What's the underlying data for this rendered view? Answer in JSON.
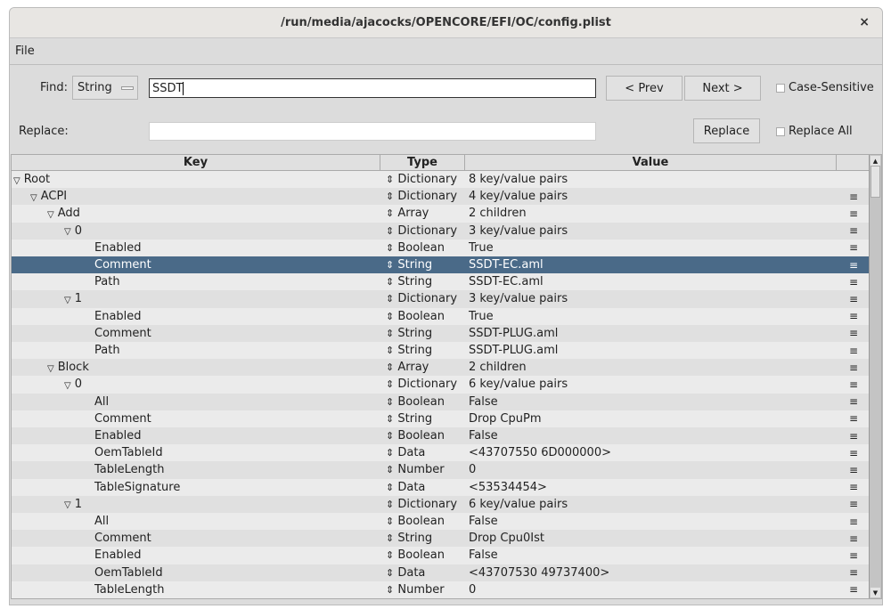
{
  "window": {
    "title": "/run/media/ajacocks/OPENCORE/EFI/OC/config.plist",
    "close": "×"
  },
  "menu": {
    "file": "File"
  },
  "find": {
    "label": "Find:",
    "mode": "String",
    "value": "SSDT",
    "prev": "< Prev",
    "next": "Next >",
    "case_sensitive": "Case-Sensitive"
  },
  "replace": {
    "label": "Replace:",
    "value": "",
    "button": "Replace",
    "replace_all": "Replace All"
  },
  "columns": {
    "key": "Key",
    "type": "Type",
    "value": "Value"
  },
  "selected_color": "#4a6a88",
  "rows": [
    {
      "key": "Root",
      "depth": 0,
      "expand": true,
      "type": "Dictionary",
      "value": "8 key/value pairs",
      "menu": ""
    },
    {
      "key": "ACPI",
      "depth": 1,
      "expand": true,
      "type": "Dictionary",
      "value": "4 key/value pairs",
      "menu": "≡"
    },
    {
      "key": "Add",
      "depth": 2,
      "expand": true,
      "type": "Array",
      "value": "2 children",
      "menu": "≡"
    },
    {
      "key": "0",
      "depth": 3,
      "expand": true,
      "type": "Dictionary",
      "value": "3 key/value pairs",
      "menu": "≡"
    },
    {
      "key": "Enabled",
      "depth": 4,
      "type": "Boolean",
      "value": "True",
      "menu": "≡"
    },
    {
      "key": "Comment",
      "depth": 4,
      "type": "String",
      "value": "SSDT-EC.aml",
      "menu": "≡",
      "selected": true
    },
    {
      "key": "Path",
      "depth": 4,
      "type": "String",
      "value": "SSDT-EC.aml",
      "menu": "≡"
    },
    {
      "key": "1",
      "depth": 3,
      "expand": true,
      "type": "Dictionary",
      "value": "3 key/value pairs",
      "menu": "≡"
    },
    {
      "key": "Enabled",
      "depth": 4,
      "type": "Boolean",
      "value": "True",
      "menu": "≡"
    },
    {
      "key": "Comment",
      "depth": 4,
      "type": "String",
      "value": "SSDT-PLUG.aml",
      "menu": "≡"
    },
    {
      "key": "Path",
      "depth": 4,
      "type": "String",
      "value": "SSDT-PLUG.aml",
      "menu": "≡"
    },
    {
      "key": "Block",
      "depth": 2,
      "expand": true,
      "type": "Array",
      "value": "2 children",
      "menu": "≡"
    },
    {
      "key": "0",
      "depth": 3,
      "expand": true,
      "type": "Dictionary",
      "value": "6 key/value pairs",
      "menu": "≡"
    },
    {
      "key": "All",
      "depth": 4,
      "type": "Boolean",
      "value": "False",
      "menu": "≡"
    },
    {
      "key": "Comment",
      "depth": 4,
      "type": "String",
      "value": "Drop CpuPm",
      "menu": "≡"
    },
    {
      "key": "Enabled",
      "depth": 4,
      "type": "Boolean",
      "value": "False",
      "menu": "≡"
    },
    {
      "key": "OemTableId",
      "depth": 4,
      "type": "Data",
      "value": "<43707550 6D000000>",
      "menu": "≡"
    },
    {
      "key": "TableLength",
      "depth": 4,
      "type": "Number",
      "value": "0",
      "menu": "≡"
    },
    {
      "key": "TableSignature",
      "depth": 4,
      "type": "Data",
      "value": "<53534454>",
      "menu": "≡"
    },
    {
      "key": "1",
      "depth": 3,
      "expand": true,
      "type": "Dictionary",
      "value": "6 key/value pairs",
      "menu": "≡"
    },
    {
      "key": "All",
      "depth": 4,
      "type": "Boolean",
      "value": "False",
      "menu": "≡"
    },
    {
      "key": "Comment",
      "depth": 4,
      "type": "String",
      "value": "Drop Cpu0Ist",
      "menu": "≡"
    },
    {
      "key": "Enabled",
      "depth": 4,
      "type": "Boolean",
      "value": "False",
      "menu": "≡"
    },
    {
      "key": "OemTableId",
      "depth": 4,
      "type": "Data",
      "value": "<43707530 49737400>",
      "menu": "≡"
    },
    {
      "key": "TableLength",
      "depth": 4,
      "type": "Number",
      "value": "0",
      "menu": "≡"
    }
  ]
}
